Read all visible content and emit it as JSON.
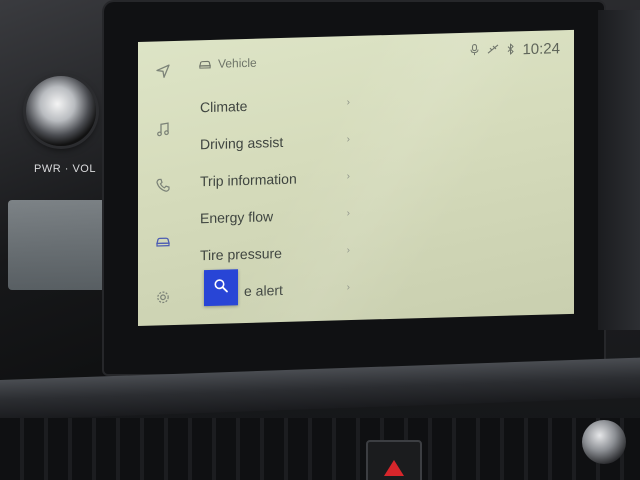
{
  "hardware": {
    "knob_label": "PWR · VOL"
  },
  "header": {
    "title": "Vehicle",
    "icon": "car-icon"
  },
  "status_bar": {
    "time": "10:24",
    "icons": [
      "microphone-off-icon",
      "phone-signal-icon",
      "bluetooth-icon"
    ]
  },
  "side_rail": [
    {
      "name": "navigation",
      "icon": "navigation-arrow-icon"
    },
    {
      "name": "media",
      "icon": "music-note-icon"
    },
    {
      "name": "phone",
      "icon": "phone-icon"
    },
    {
      "name": "vehicle",
      "icon": "car-icon"
    },
    {
      "name": "settings",
      "icon": "gear-icon"
    }
  ],
  "menu": {
    "items": [
      {
        "label": "Climate"
      },
      {
        "label": "Driving assist"
      },
      {
        "label": "Trip information"
      },
      {
        "label": "Energy flow"
      },
      {
        "label": "Tire pressure"
      },
      {
        "label": "e alert"
      }
    ]
  },
  "search": {
    "icon": "search-icon",
    "color": "#2845d6"
  },
  "colors": {
    "screen_background": "#d6dcbc",
    "text": "#3f4540",
    "accent": "#2845d6",
    "hazard": "#d7262b"
  }
}
